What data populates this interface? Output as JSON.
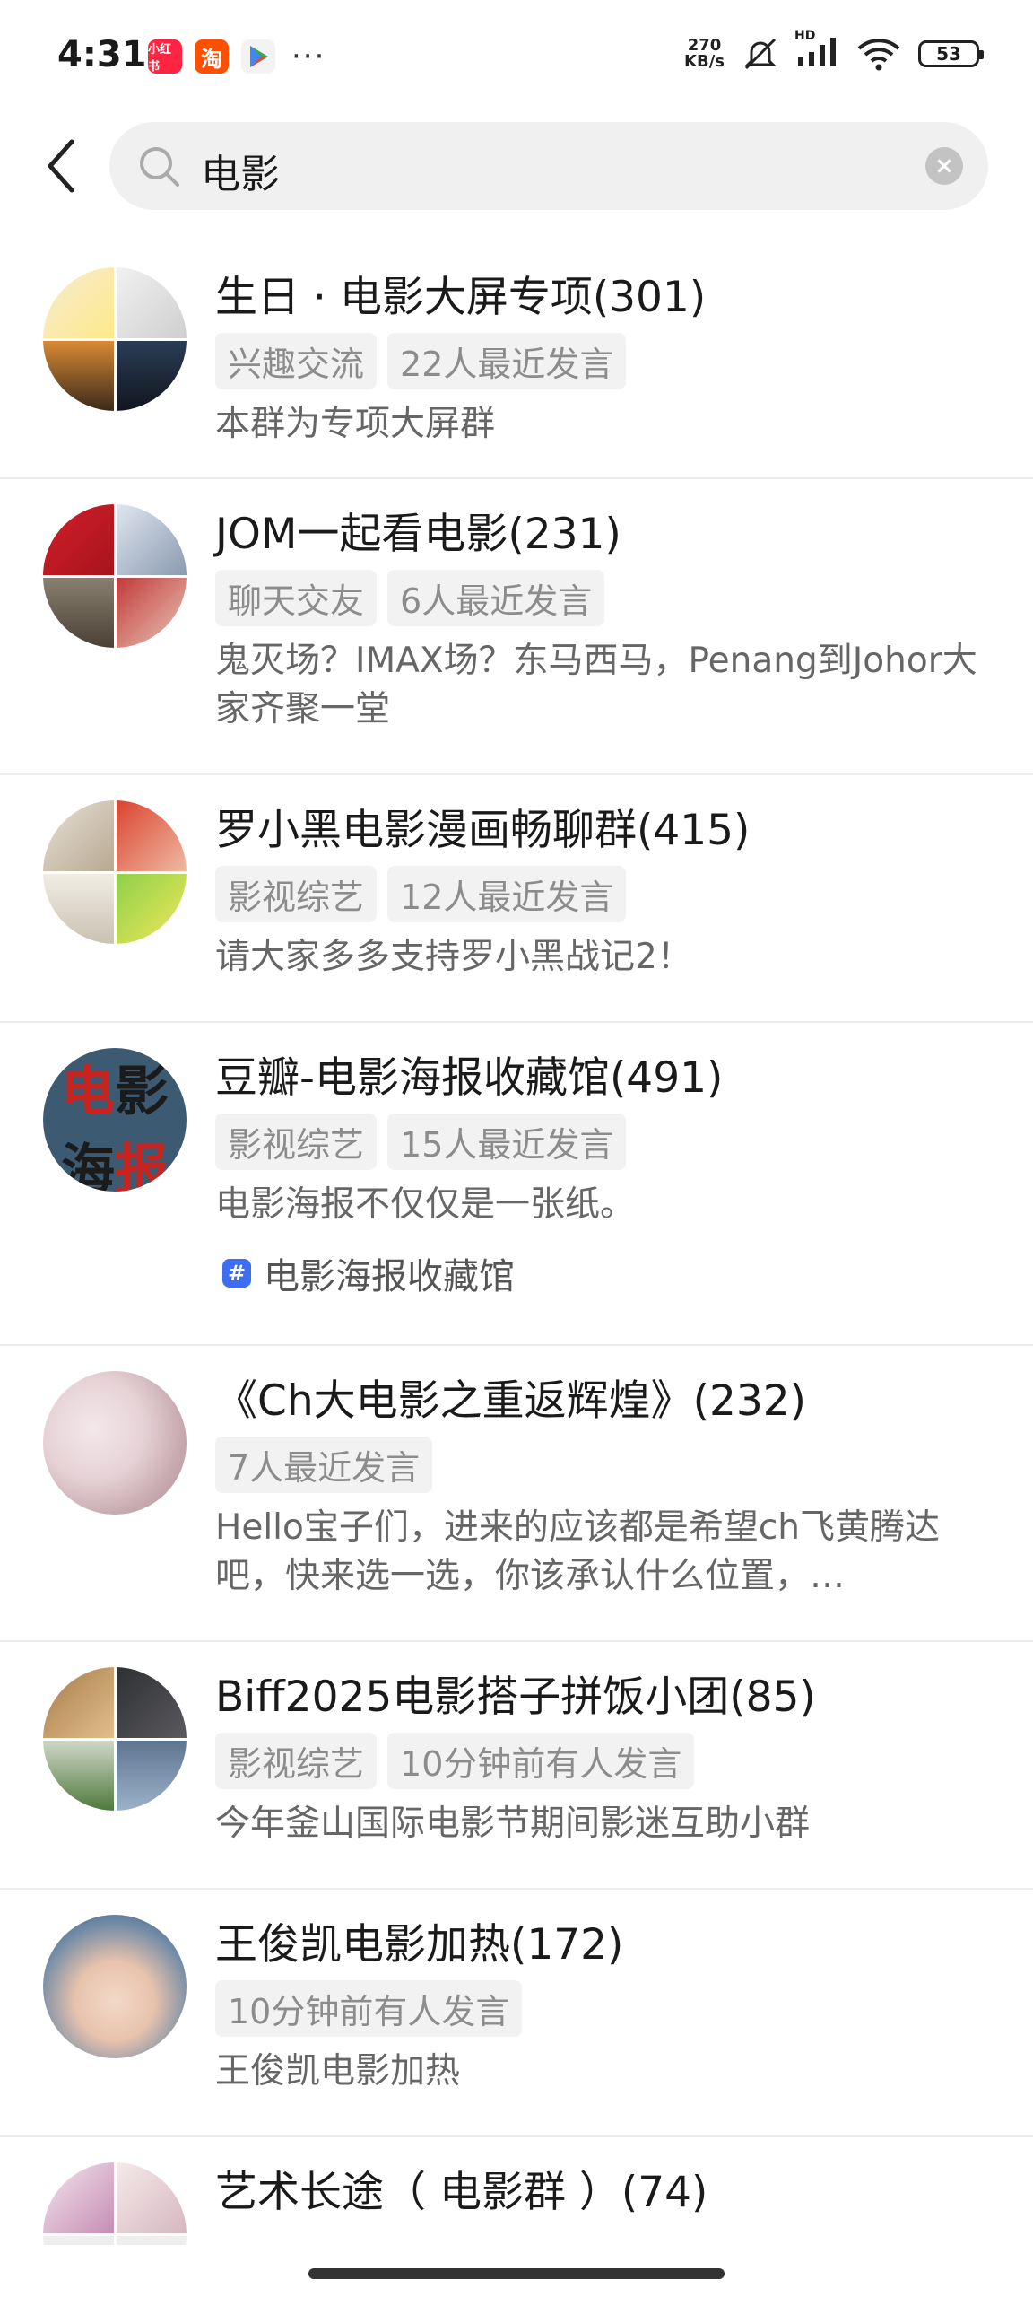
{
  "status_bar": {
    "time": "4:31",
    "apps": [
      {
        "label": "小红书",
        "color": "#ff2442"
      },
      {
        "label": "淘",
        "color": "#ff5000"
      }
    ],
    "more": "···",
    "net_speed_value": "270",
    "net_speed_unit": "KB/s",
    "network_badge": "HD",
    "battery": "53"
  },
  "search": {
    "query": "电影"
  },
  "results": [
    {
      "title": "生日 · 电影大屏专项(301)",
      "tags": [
        "兴趣交流",
        "22人最近发言"
      ],
      "desc": "本群为专项大屏群"
    },
    {
      "title": "JOM一起看电影(231)",
      "tags": [
        "聊天交友",
        "6人最近发言"
      ],
      "desc": "鬼灭场？IMAX场？东马西马，Penang到Johor大家齐聚一堂"
    },
    {
      "title": "罗小黑电影漫画畅聊群(415)",
      "tags": [
        "影视综艺",
        "12人最近发言"
      ],
      "desc": "请大家多多支持罗小黑战记2！"
    },
    {
      "title": "豆瓣-电影海报收藏馆(491)",
      "tags": [
        "影视综艺",
        "15人最近发言"
      ],
      "desc": "电影海报不仅仅是一张纸。",
      "topic": "电影海报收藏馆",
      "avatar_text": [
        "电",
        "影",
        "海",
        "报"
      ]
    },
    {
      "title": "《Ch大电影之重返辉煌》(232)",
      "tags": [
        "7人最近发言"
      ],
      "desc": "Hello宝子们，进来的应该都是希望ch飞黄腾达吧，快来选一选，你该承认什么位置，…"
    },
    {
      "title": "Biff2025电影搭子拼饭小团(85)",
      "tags": [
        "影视综艺",
        "10分钟前有人发言"
      ],
      "desc": "今年釜山国际电影节期间影迷互助小群"
    },
    {
      "title": "王俊凯电影加热(172)",
      "tags": [
        "10分钟前有人发言"
      ],
      "desc": "王俊凯电影加热"
    },
    {
      "title": "艺术长途（ 电影群 ）(74)",
      "tags": [],
      "desc": ""
    }
  ]
}
